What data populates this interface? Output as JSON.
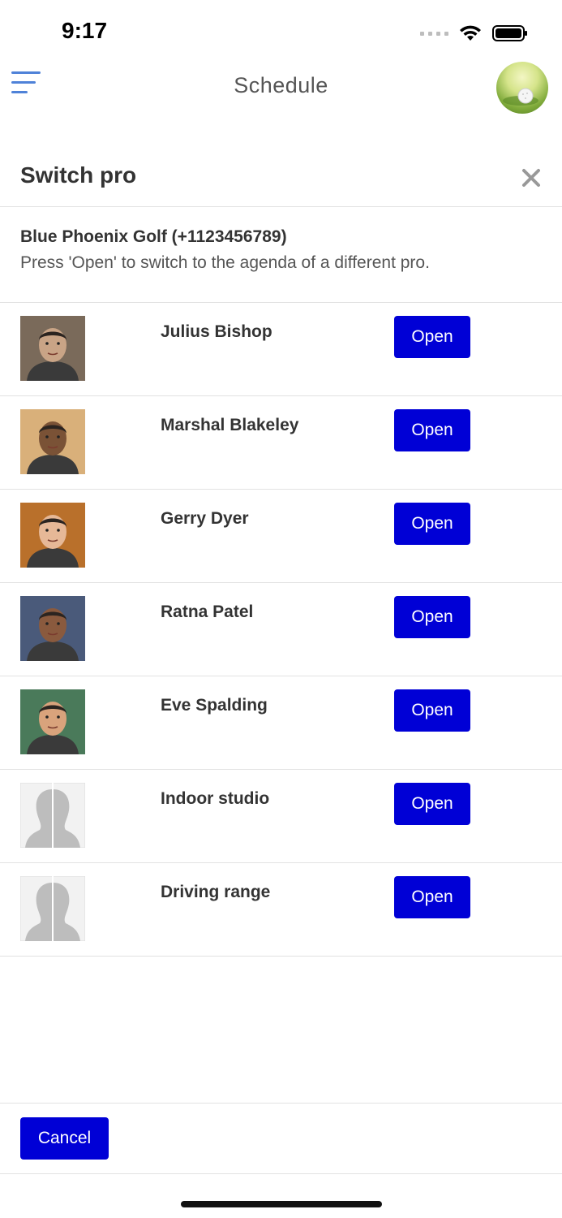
{
  "status_bar": {
    "time": "9:17"
  },
  "header": {
    "title": "Schedule",
    "menu_icon": "hamburger-menu-icon",
    "avatar_icon": "golf-ball-avatar"
  },
  "modal": {
    "title": "Switch pro",
    "close_icon": "close-icon",
    "club_name": "Blue Phoenix Golf (+1123456789)",
    "hint": "Press 'Open' to switch to the agenda of a different pro."
  },
  "pros": [
    {
      "name": "Julius Bishop",
      "open_label": "Open",
      "photo": "photo",
      "tone": [
        "#7a6a5a",
        "#c9a486"
      ]
    },
    {
      "name": "Marshal Blakeley",
      "open_label": "Open",
      "photo": "photo",
      "tone": [
        "#d9b07a",
        "#7a5236"
      ]
    },
    {
      "name": "Gerry Dyer",
      "open_label": "Open",
      "photo": "photo",
      "tone": [
        "#b9702b",
        "#e6b897"
      ]
    },
    {
      "name": "Ratna Patel",
      "open_label": "Open",
      "photo": "photo",
      "tone": [
        "#4a5a7a",
        "#8a5a3e"
      ]
    },
    {
      "name": "Eve Spalding",
      "open_label": "Open",
      "photo": "photo",
      "tone": [
        "#4a7a5a",
        "#d9a37c"
      ]
    },
    {
      "name": "Indoor studio",
      "open_label": "Open",
      "photo": "placeholder",
      "tone": [
        "#f2f2f2",
        "#bdbdbd"
      ]
    },
    {
      "name": "Driving range",
      "open_label": "Open",
      "photo": "placeholder",
      "tone": [
        "#f2f2f2",
        "#bdbdbd"
      ]
    }
  ],
  "footer": {
    "cancel_label": "Cancel"
  },
  "colors": {
    "primary_button": "#0000d6",
    "menu_icon": "#4f82d8"
  }
}
